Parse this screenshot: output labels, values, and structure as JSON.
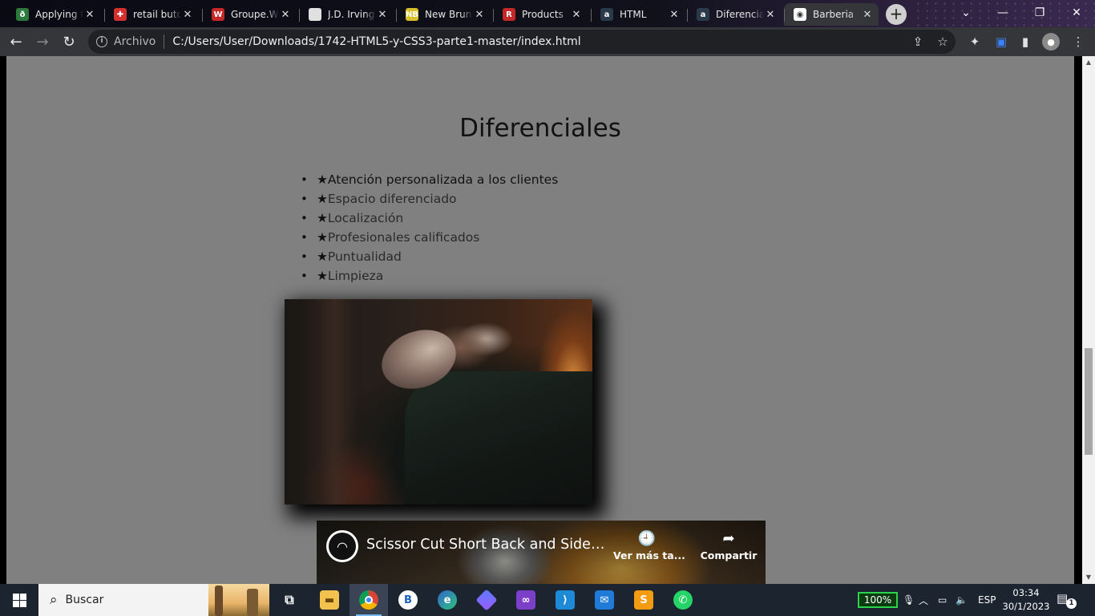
{
  "browser": {
    "tabs": [
      {
        "title": "Applying f",
        "favicon_text": "ð",
        "favicon_color": "#2b7a3b",
        "active": false
      },
      {
        "title": "retail buto",
        "favicon_text": "✚",
        "favicon_color": "#d32f2f",
        "active": false
      },
      {
        "title": "Groupe.W",
        "favicon_text": "W",
        "favicon_color": "#c62828",
        "active": false
      },
      {
        "title": "J.D. Irving",
        "favicon_text": "",
        "favicon_color": "#e0e0e0",
        "active": false
      },
      {
        "title": "New Bruns",
        "favicon_text": "NB",
        "favicon_color": "#d7c02b",
        "active": false
      },
      {
        "title": "Products",
        "favicon_text": "R",
        "favicon_color": "#c62828",
        "active": false
      },
      {
        "title": "HTML",
        "favicon_text": "a",
        "favicon_color": "#2b3a4a",
        "active": false
      },
      {
        "title": "Diferencia",
        "favicon_text": "a",
        "favicon_color": "#2b3a4a",
        "active": false
      },
      {
        "title": "Barberia",
        "favicon_text": "◉",
        "favicon_color": "#ffffff",
        "active": true
      }
    ],
    "new_tab": "+",
    "address": {
      "scheme_label": "Archivo",
      "url": "C:/Users/User/Downloads/1742-HTML5-y-CSS3-parte1-master/index.html"
    }
  },
  "page": {
    "heading": "Diferenciales",
    "star": "★",
    "features": [
      "Atención personalizada a los clientes",
      "Espacio diferenciado",
      "Localización",
      "Profesionales calificados",
      "Puntualidad",
      "Limpieza"
    ],
    "video": {
      "title": "Scissor Cut Short Back and Sides M...",
      "watch_later": "Ver más ta...",
      "share": "Compartir"
    }
  },
  "taskbar": {
    "search_placeholder": "Buscar",
    "battery": "100%",
    "language": "ESP",
    "time": "03:34",
    "date": "30/1/2023",
    "notifications": "1"
  }
}
